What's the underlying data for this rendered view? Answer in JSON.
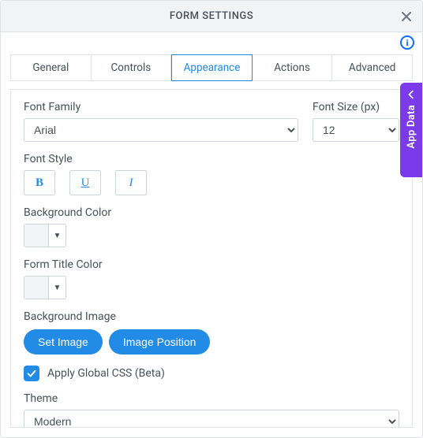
{
  "dialog": {
    "title": "FORM SETTINGS"
  },
  "tabs": {
    "general": "General",
    "controls": "Controls",
    "appearance": "Appearance",
    "actions": "Actions",
    "advanced": "Advanced"
  },
  "sideTab": {
    "label": "App Data"
  },
  "fontFamily": {
    "label": "Font Family",
    "value": "Arial"
  },
  "fontSize": {
    "label": "Font Size (px)",
    "value": "12"
  },
  "fontStyle": {
    "label": "Font Style",
    "bold": "B",
    "underline": "U",
    "italic": "I"
  },
  "bgColor": {
    "label": "Background Color"
  },
  "titleColor": {
    "label": "Form Title Color"
  },
  "bgImage": {
    "label": "Background Image",
    "setImage": "Set Image",
    "imagePosition": "Image Position"
  },
  "globalCss": {
    "label": "Apply Global CSS (Beta)",
    "checked": true
  },
  "theme": {
    "label": "Theme",
    "value": "Modern"
  }
}
